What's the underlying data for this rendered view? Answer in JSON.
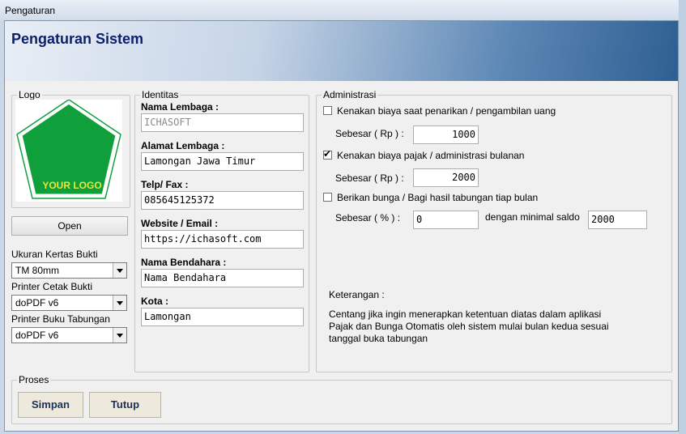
{
  "window": {
    "title": "Pengaturan"
  },
  "header": {
    "title": "Pengaturan Sistem"
  },
  "logo_group": {
    "legend": "Logo",
    "logo_text": "YOUR LOGO",
    "open_label": "Open",
    "paper_label": "Ukuran Kertas Bukti",
    "paper_value": "TM 80mm",
    "printer_receipt_label": "Printer Cetak Bukti",
    "printer_receipt_value": "doPDF v6",
    "printer_book_label": "Printer Buku Tabungan",
    "printer_book_value": "doPDF v6"
  },
  "identity": {
    "legend": "Identitas",
    "name_label": "Nama Lembaga :",
    "name_value": "ICHASOFT",
    "address_label": "Alamat Lembaga :",
    "address_value": "Lamongan Jawa Timur",
    "phone_label": "Telp/ Fax :",
    "phone_value": "085645125372",
    "website_label": "Website / Email  :",
    "website_value": "https://ichasoft.com",
    "treasurer_label": "Nama Bendahara :",
    "treasurer_value": "Nama Bendahara",
    "city_label": "Kota :",
    "city_value": "Lamongan"
  },
  "admin": {
    "legend": "Administrasi",
    "withdraw_label": "Kenakan biaya saat penarikan / pengambilan uang",
    "withdraw_checked": false,
    "withdraw_amount_label": "Sebesar ( Rp ) :",
    "withdraw_amount": "1000",
    "tax_label": "Kenakan biaya pajak / administrasi bulanan",
    "tax_checked": true,
    "tax_amount_label": "Sebesar ( Rp ) :",
    "tax_amount": "2000",
    "interest_label": "Berikan bunga / Bagi hasil tabungan tiap bulan",
    "interest_checked": false,
    "interest_rate_label": "Sebesar ( % ) :",
    "interest_rate": "0",
    "min_balance_label": "dengan minimal saldo",
    "min_balance": "2000",
    "note_title": "Keterangan :",
    "note_line1": "Centang jika ingin menerapkan ketentuan diatas dalam aplikasi",
    "note_line2": "Pajak dan Bunga Otomatis oleh sistem mulai bulan kedua sesuai",
    "note_line3": "tanggal buka tabungan"
  },
  "process": {
    "legend": "Proses",
    "save_label": "Simpan",
    "close_label": "Tutup"
  },
  "colors": {
    "header_title": "#0b1f6a",
    "logo_fill": "#0fa03c",
    "logo_text": "#e8e83a"
  }
}
